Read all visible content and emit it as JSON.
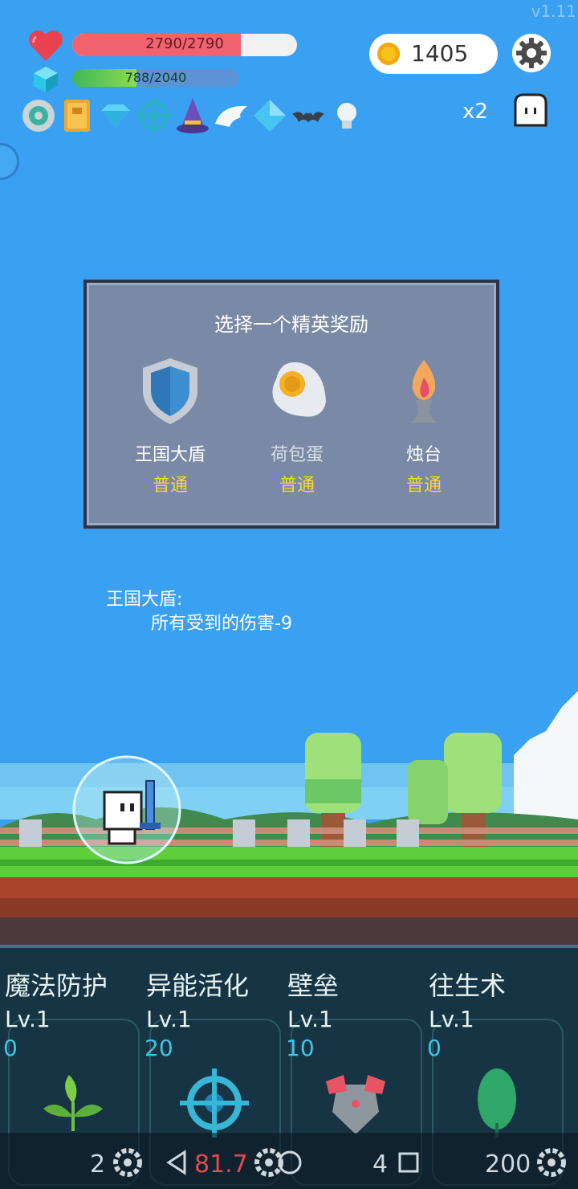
{
  "version": "v1.11",
  "hud": {
    "hp": {
      "current": 2790,
      "max": 2790,
      "text": "2790/2790",
      "fill_fraction": 0.75
    },
    "mana": {
      "current": 788,
      "max": 2040,
      "text": "788/2040",
      "fill_fraction": 0.386
    },
    "coins": "1405",
    "speed_label": "x2",
    "relic_icons": [
      "disc-relic-icon",
      "book-relic-icon",
      "gem-relic-icon",
      "target-relic-icon",
      "wizard-hat-relic-icon",
      "wings-relic-icon",
      "diamond-relic-icon",
      "bat-relic-icon",
      "lightbulb-relic-icon"
    ]
  },
  "colors": {
    "sky": "#3aa0f2",
    "hp": "#f0626e",
    "dialog_bg": "#7a8aa6",
    "rarity": "#f6d83a",
    "panel_bg": "#173444",
    "cost": "#3cc6e4"
  },
  "dialog": {
    "title": "选择一个精英奖励",
    "options": [
      {
        "name": "王国大盾",
        "rarity": "普通",
        "icon": "shield-icon"
      },
      {
        "name": "荷包蛋",
        "rarity": "普通",
        "icon": "fried-egg-icon"
      },
      {
        "name": "烛台",
        "rarity": "普通",
        "icon": "candlestick-icon"
      }
    ]
  },
  "description": {
    "title": "王国大盾:",
    "body": "所有受到的伤害-9"
  },
  "skills": [
    {
      "name": "魔法防护",
      "level": "Lv.1",
      "cost": "0",
      "icon": "leaf-sprout-icon",
      "count": "2"
    },
    {
      "name": "异能活化",
      "level": "Lv.1",
      "cost": "20",
      "icon": "crosshair-icon",
      "count": "81.7"
    },
    {
      "name": "壁垒",
      "level": "Lv.1",
      "cost": "10",
      "icon": "armor-icon",
      "count": "4"
    },
    {
      "name": "往生术",
      "level": "Lv.1",
      "cost": "0",
      "icon": "leaf-icon",
      "count": "200"
    }
  ]
}
